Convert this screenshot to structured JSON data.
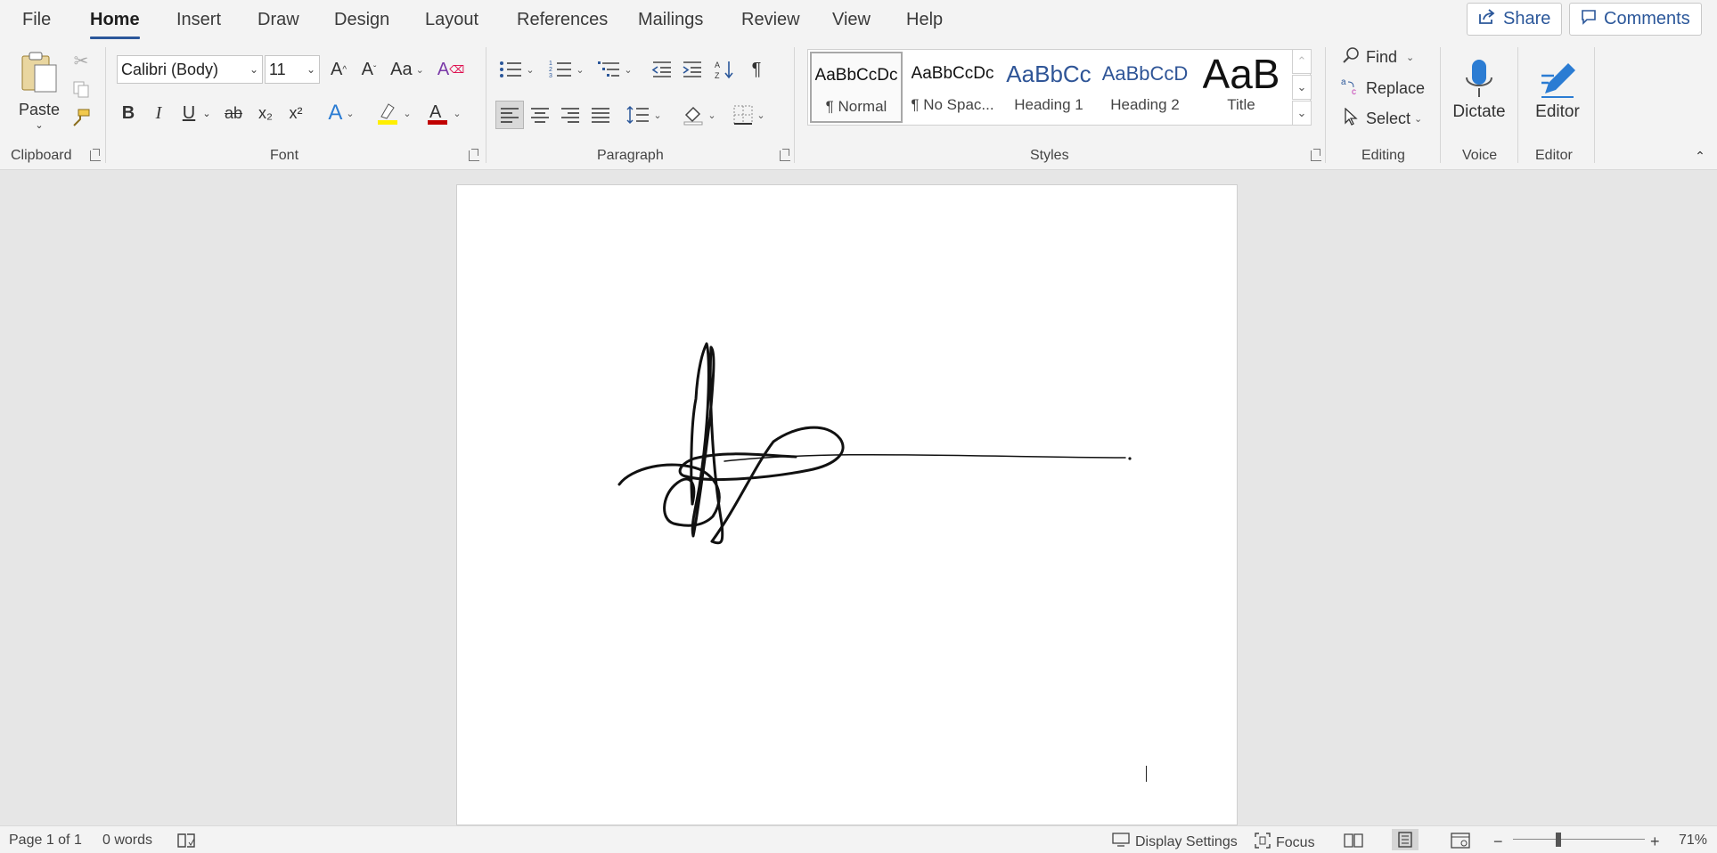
{
  "menu": {
    "tabs": [
      {
        "label": "File"
      },
      {
        "label": "Home"
      },
      {
        "label": "Insert"
      },
      {
        "label": "Draw"
      },
      {
        "label": "Design"
      },
      {
        "label": "Layout"
      },
      {
        "label": "References"
      },
      {
        "label": "Mailings"
      },
      {
        "label": "Review"
      },
      {
        "label": "View"
      },
      {
        "label": "Help"
      }
    ],
    "active_tab": "Home",
    "share_label": "Share",
    "comments_label": "Comments"
  },
  "clipboard": {
    "paste_label": "Paste",
    "group_label": "Clipboard"
  },
  "font": {
    "family": "Calibri (Body)",
    "size": "11",
    "group_label": "Font",
    "bold": "B",
    "italic": "I",
    "underline": "U",
    "strike": "ab",
    "subscript": "x₂",
    "superscript": "x²",
    "change_case": "Aa",
    "highlight_color": "#ffef00",
    "font_color": "#c00000"
  },
  "paragraph": {
    "group_label": "Paragraph",
    "pilcrow": "¶"
  },
  "styles": {
    "group_label": "Styles",
    "items": [
      {
        "preview": "AaBbCcDc",
        "name": "¶ Normal"
      },
      {
        "preview": "AaBbCcDc",
        "name": "¶ No Spac..."
      },
      {
        "preview": "AaBbCc",
        "name": "Heading 1"
      },
      {
        "preview": "AaBbCcD",
        "name": "Heading 2"
      },
      {
        "preview": "AaB",
        "name": "Title"
      }
    ],
    "selected": "¶ Normal"
  },
  "editing": {
    "group_label": "Editing",
    "find_label": "Find",
    "replace_label": "Replace",
    "select_label": "Select"
  },
  "voice": {
    "group_label": "Voice",
    "dictate_label": "Dictate"
  },
  "editor": {
    "group_label": "Editor",
    "editor_label": "Editor"
  },
  "status": {
    "page": "Page 1 of 1",
    "words": "0 words",
    "display_settings": "Display Settings",
    "focus": "Focus",
    "zoom": "71%"
  },
  "colors": {
    "accent": "#2b579a",
    "ribbon_bg": "#f3f3f3",
    "canvas_bg": "#e6e6e6"
  }
}
